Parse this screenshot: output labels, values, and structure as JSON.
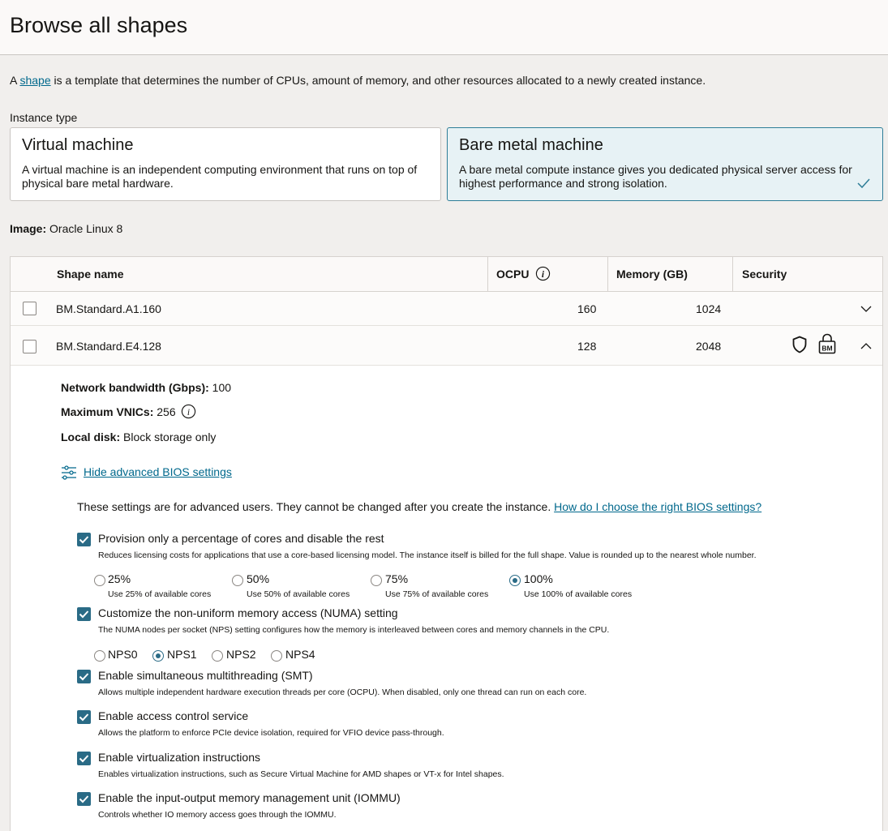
{
  "header": {
    "title": "Browse all shapes"
  },
  "intro": {
    "prefix": "A ",
    "link": "shape",
    "suffix": " is a template that determines the number of CPUs, amount of memory, and other resources allocated to a newly created instance."
  },
  "instance_type": {
    "label": "Instance type",
    "options": [
      {
        "title": "Virtual machine",
        "desc": "A virtual machine is an independent computing environment that runs on top of physical bare metal hardware.",
        "selected": false
      },
      {
        "title": "Bare metal machine",
        "desc": "A bare metal compute instance gives you dedicated physical server access for highest performance and strong isolation.",
        "selected": true
      }
    ]
  },
  "image": {
    "label": "Image:",
    "value": "Oracle Linux 8"
  },
  "table": {
    "columns": [
      "Shape name",
      "OCPU",
      "Memory (GB)",
      "Security"
    ],
    "rows": [
      {
        "name": "BM.Standard.A1.160",
        "ocpu": "160",
        "memory": "1024",
        "expanded": false
      },
      {
        "name": "BM.Standard.E4.128",
        "ocpu": "128",
        "memory": "2048",
        "expanded": true,
        "security_icons": [
          "shield-icon",
          "bm-lock-icon"
        ],
        "bm_badge": "BM"
      }
    ]
  },
  "details": {
    "network_label": "Network bandwidth (Gbps):",
    "network_value": "100",
    "vnics_label": "Maximum VNICs:",
    "vnics_value": "256",
    "disk_label": "Local disk:",
    "disk_value": "Block storage only",
    "bios_link": "Hide advanced BIOS settings",
    "bios_note": "These settings are for advanced users. They cannot be changed after you create the instance.",
    "bios_help_link": "How do I choose the right BIOS settings?"
  },
  "bios": {
    "cores": {
      "label": "Provision only a percentage of cores and disable the rest",
      "desc": "Reduces licensing costs for applications that use a core-based licensing model. The instance itself is billed for the full shape. Value is rounded up to the nearest whole number.",
      "checked": true,
      "options": [
        {
          "label": "25%",
          "sub": "Use 25% of available cores",
          "selected": false
        },
        {
          "label": "50%",
          "sub": "Use 50% of available cores",
          "selected": false
        },
        {
          "label": "75%",
          "sub": "Use 75% of available cores",
          "selected": false
        },
        {
          "label": "100%",
          "sub": "Use 100% of available cores",
          "selected": true
        }
      ]
    },
    "numa": {
      "label": "Customize the non-uniform memory access (NUMA) setting",
      "desc": "The NUMA nodes per socket (NPS) setting configures how the memory is interleaved between cores and memory channels in the CPU.",
      "checked": true,
      "options": [
        {
          "label": "NPS0",
          "selected": false
        },
        {
          "label": "NPS1",
          "selected": true
        },
        {
          "label": "NPS2",
          "selected": false
        },
        {
          "label": "NPS4",
          "selected": false
        }
      ]
    },
    "smt": {
      "label": "Enable simultaneous multithreading (SMT)",
      "desc": "Allows multiple independent hardware execution threads per core (OCPU). When disabled, only one thread can run on each core.",
      "checked": true
    },
    "acs": {
      "label": "Enable access control service",
      "desc": "Allows the platform to enforce PCIe device isolation, required for VFIO device pass-through.",
      "checked": true
    },
    "virt": {
      "label": "Enable virtualization instructions",
      "desc": "Enables virtualization instructions, such as Secure Virtual Machine for AMD shapes or VT-x for Intel shapes.",
      "checked": true
    },
    "iommu": {
      "label": "Enable the input-output memory management unit (IOMMU)",
      "desc": "Controls whether IO memory access goes through the IOMMU.",
      "checked": true
    }
  }
}
